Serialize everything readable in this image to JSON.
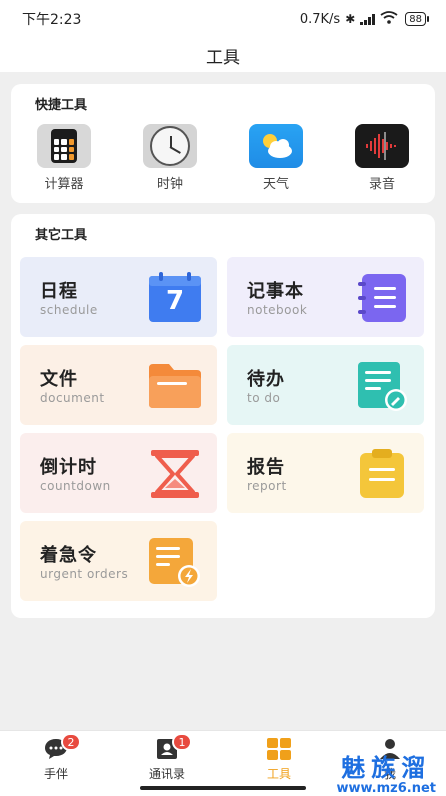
{
  "status_bar": {
    "time": "下午2:23",
    "network_speed": "0.7K/s",
    "battery": "88",
    "icons": [
      "bluetooth-icon",
      "hd-icon",
      "signal-icon",
      "wifi-icon",
      "battery-icon"
    ]
  },
  "header": {
    "title": "工具"
  },
  "quick_tools": {
    "title": "快捷工具",
    "items": [
      {
        "label": "计算器",
        "icon": "calculator-icon"
      },
      {
        "label": "时钟",
        "icon": "clock-icon"
      },
      {
        "label": "天气",
        "icon": "weather-icon"
      },
      {
        "label": "录音",
        "icon": "recorder-icon"
      }
    ]
  },
  "other_tools": {
    "title": "其它工具",
    "items": [
      {
        "name": "日程",
        "sub": "schedule",
        "icon": "calendar-icon",
        "icon_text": "7",
        "bg": "#e9edf9",
        "color": "#3f7cf0"
      },
      {
        "name": "记事本",
        "sub": "notebook",
        "icon": "notebook-icon",
        "bg": "#f0eefb",
        "color": "#7b66f0"
      },
      {
        "name": "文件",
        "sub": "document",
        "icon": "folder-icon",
        "bg": "#fcf0e6",
        "color": "#f48a3a"
      },
      {
        "name": "待办",
        "sub": "to do",
        "icon": "todo-icon",
        "bg": "#e6f6f5",
        "color": "#2fbfb0"
      },
      {
        "name": "倒计时",
        "sub": "countdown",
        "icon": "hourglass-icon",
        "bg": "#fbeeed",
        "color": "#ef5d4c"
      },
      {
        "name": "报告",
        "sub": "report",
        "icon": "clipboard-icon",
        "bg": "#fdf7ea",
        "color": "#f4c63a"
      },
      {
        "name": "着急令",
        "sub": "urgent orders",
        "icon": "urgent-icon",
        "bg": "#fdf3e6",
        "color": "#f4a73a"
      }
    ]
  },
  "tabbar": {
    "tabs": [
      {
        "label": "手伴",
        "icon": "chat-icon",
        "badge": "2",
        "active": false
      },
      {
        "label": "通讯录",
        "icon": "contacts-icon",
        "badge": "1",
        "active": false
      },
      {
        "label": "工具",
        "icon": "tools-icon",
        "badge": "",
        "active": true
      },
      {
        "label": "我",
        "icon": "profile-icon",
        "badge": "",
        "active": false
      }
    ]
  },
  "watermark": {
    "line1": "魅族溜",
    "line2": "www.mz6.net"
  },
  "colors": {
    "accent": "#f0a01a",
    "badge": "#e84a3f"
  }
}
